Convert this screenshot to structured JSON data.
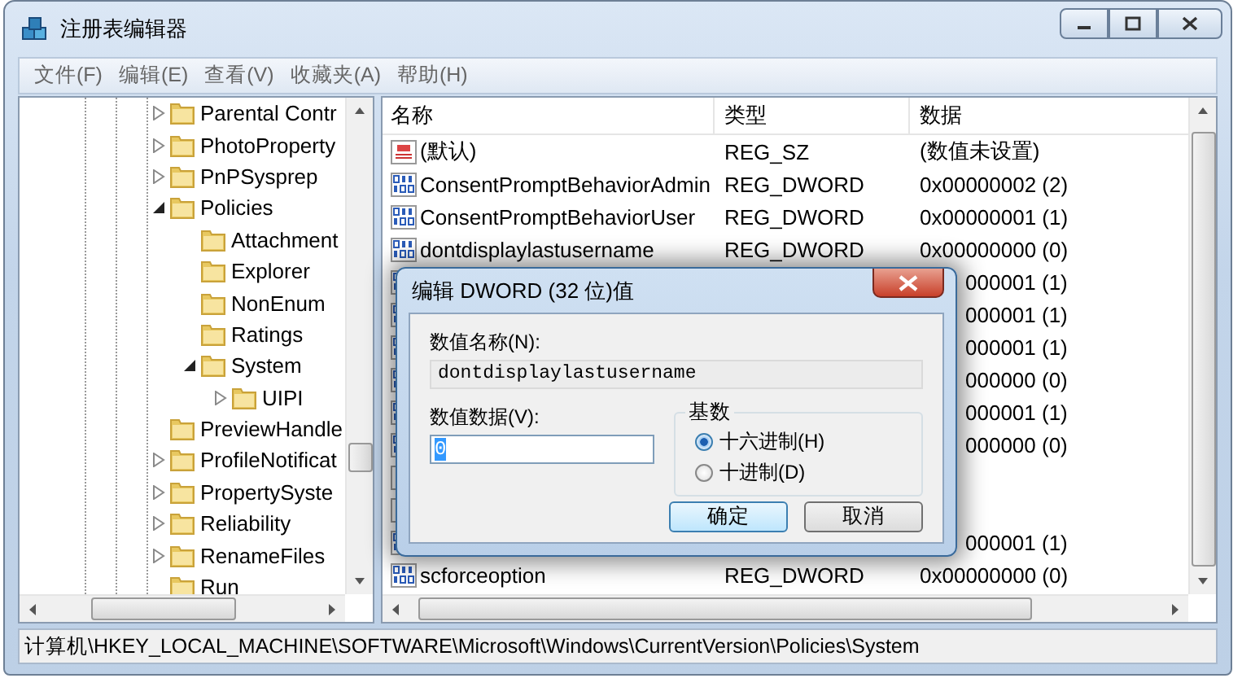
{
  "window": {
    "title": "注册表编辑器"
  },
  "menu": [
    "文件(F)",
    "编辑(E)",
    "查看(V)",
    "收藏夹(A)",
    "帮助(H)"
  ],
  "tree": [
    {
      "label": "Parental Contr",
      "kind": "branch",
      "expanded": false
    },
    {
      "label": "PhotoProperty",
      "kind": "branch",
      "expanded": false
    },
    {
      "label": "PnPSysprep",
      "kind": "branch",
      "expanded": false
    },
    {
      "label": "Policies",
      "kind": "branch",
      "expanded": true,
      "children": [
        {
          "label": "Attachment",
          "kind": "leaf"
        },
        {
          "label": "Explorer",
          "kind": "leaf"
        },
        {
          "label": "NonEnum",
          "kind": "leaf"
        },
        {
          "label": "Ratings",
          "kind": "leaf"
        },
        {
          "label": "System",
          "kind": "branch",
          "expanded": true,
          "children": [
            {
              "label": "UIPI",
              "kind": "branch",
              "expanded": false
            }
          ]
        }
      ]
    },
    {
      "label": "PreviewHandle",
      "kind": "leaf"
    },
    {
      "label": "ProfileNotificat",
      "kind": "branch",
      "expanded": false
    },
    {
      "label": "PropertySyste",
      "kind": "branch",
      "expanded": false
    },
    {
      "label": "Reliability",
      "kind": "branch",
      "expanded": false
    },
    {
      "label": "RenameFiles",
      "kind": "branch",
      "expanded": false
    },
    {
      "label": "Run",
      "kind": "leaf"
    }
  ],
  "table": {
    "columns": [
      "名称",
      "类型",
      "数据"
    ],
    "rows": [
      {
        "kind": "string",
        "name": "(默认)",
        "type": "REG_SZ",
        "data": "(数值未设置)"
      },
      {
        "kind": "dword",
        "name": "ConsentPromptBehaviorAdmin",
        "type": "REG_DWORD",
        "data": "0x00000002 (2)"
      },
      {
        "kind": "dword",
        "name": "ConsentPromptBehaviorUser",
        "type": "REG_DWORD",
        "data": "0x00000001 (1)"
      },
      {
        "kind": "dword",
        "name": "dontdisplaylastusername",
        "type": "REG_DWORD",
        "data": "0x00000000 (0)"
      },
      {
        "kind": "dword",
        "data": "000001 (1)"
      },
      {
        "kind": "dword",
        "data": "000001 (1)"
      },
      {
        "kind": "dword",
        "data": "000001 (1)"
      },
      {
        "kind": "dword",
        "data": "000000 (0)"
      },
      {
        "kind": "dword",
        "data": "000001 (1)"
      },
      {
        "kind": "dword",
        "data": "000000 (0)"
      },
      {
        "kind": "string"
      },
      {
        "kind": "string"
      },
      {
        "kind": "dword",
        "data": "000001 (1)"
      },
      {
        "kind": "dword",
        "name": "scforceoption",
        "type": "REG_DWORD",
        "data": "0x00000000 (0)"
      }
    ]
  },
  "status_bar": "计算机\\HKEY_LOCAL_MACHINE\\SOFTWARE\\Microsoft\\Windows\\CurrentVersion\\Policies\\System",
  "dialog": {
    "title": "编辑 DWORD (32 位)值",
    "name_label": "数值名称(N):",
    "name_value": "dontdisplaylastusername",
    "data_label": "数值数据(V):",
    "data_value": "0",
    "base_label": "基数",
    "bases": [
      {
        "label": "十六进制(H)",
        "selected": true
      },
      {
        "label": "十进制(D)",
        "selected": false
      }
    ],
    "buttons": [
      {
        "label": "确定",
        "default": true
      },
      {
        "label": "取消",
        "default": false
      }
    ]
  }
}
